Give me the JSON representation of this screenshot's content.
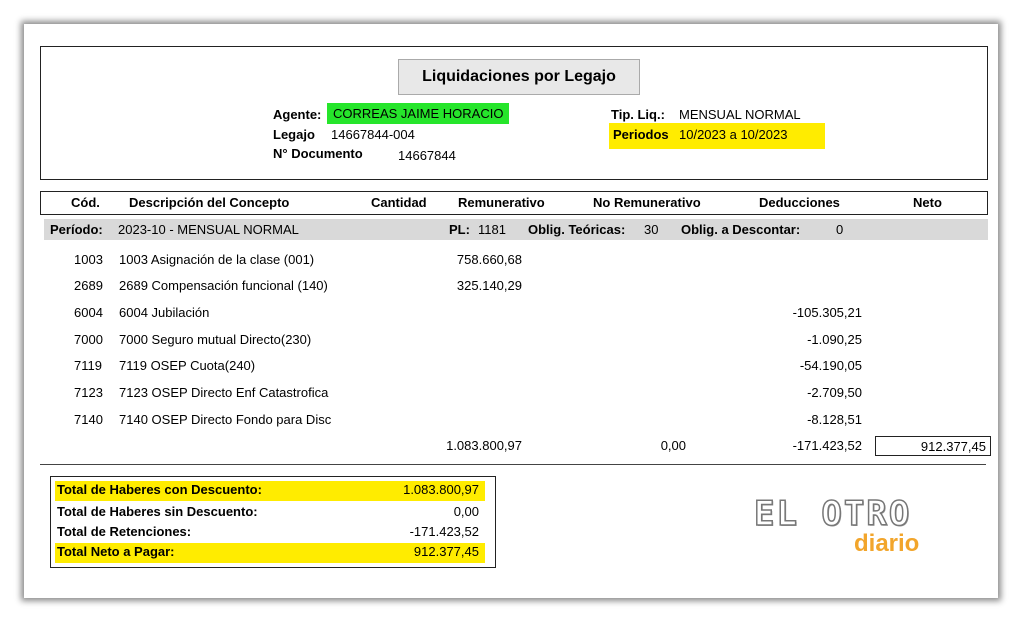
{
  "title": "Liquidaciones por Legajo",
  "agente": {
    "label": "Agente:",
    "value": "CORREAS JAIME HORACIO"
  },
  "legajo": {
    "label": "Legajo",
    "value": "14667844-004"
  },
  "documento": {
    "label": "N° Documento",
    "value": "14667844"
  },
  "tipliq": {
    "label": "Tip. Liq.:",
    "value": "MENSUAL NORMAL"
  },
  "periodos": {
    "label": "Periodos",
    "value": "10/2023 a 10/2023"
  },
  "columns": {
    "cod": "Cód.",
    "desc": "Descripción del Concepto",
    "cantidad": "Cantidad",
    "remun": "Remunerativo",
    "noremun": "No Remunerativo",
    "deduc": "Deducciones",
    "neto": "Neto"
  },
  "periodo": {
    "label": "Período:",
    "value": "2023-10 - MENSUAL NORMAL",
    "pl_label": "PL:",
    "pl_value": "1181",
    "oblig_teo_label": "Oblig. Teóricas:",
    "oblig_teo_value": "30",
    "oblig_desc_label": "Oblig. a Descontar:",
    "oblig_desc_value": "0"
  },
  "rows": [
    {
      "cod": "1003",
      "desc": "1003 Asignación de la clase (001)",
      "remun": "758.660,68",
      "deduc": ""
    },
    {
      "cod": "2689",
      "desc": "2689 Compensación funcional (140)",
      "remun": "325.140,29",
      "deduc": ""
    },
    {
      "cod": "6004",
      "desc": "6004 Jubilación",
      "remun": "",
      "deduc": "-105.305,21"
    },
    {
      "cod": "7000",
      "desc": "7000 Seguro mutual  Directo(230)",
      "remun": "",
      "deduc": "-1.090,25"
    },
    {
      "cod": "7119",
      "desc": "7119 OSEP Cuota(240)",
      "remun": "",
      "deduc": "-54.190,05"
    },
    {
      "cod": "7123",
      "desc": "7123 OSEP Directo Enf Catastrofica",
      "remun": "",
      "deduc": "-2.709,50"
    },
    {
      "cod": "7140",
      "desc": "7140 OSEP Directo Fondo para Disc",
      "remun": "",
      "deduc": "-8.128,51"
    }
  ],
  "sums": {
    "remun": "1.083.800,97",
    "noremun": "0,00",
    "deduc": "-171.423,52",
    "neto": "912.377,45"
  },
  "totals": [
    {
      "label": "Total de Haberes con Descuento:",
      "value": "1.083.800,97"
    },
    {
      "label": "Total de Haberes sin Descuento:",
      "value": "0,00"
    },
    {
      "label": "Total de Retenciones:",
      "value": "-171.423,52"
    },
    {
      "label": "Total Neto a Pagar:",
      "value": "912.377,45"
    }
  ],
  "logo": {
    "main": "EL OTRO",
    "sub": "diario"
  },
  "colors": {
    "green_highlight": "#26e52b",
    "yellow_highlight": "#ffec00",
    "logo_orange": "#f2a52b"
  }
}
